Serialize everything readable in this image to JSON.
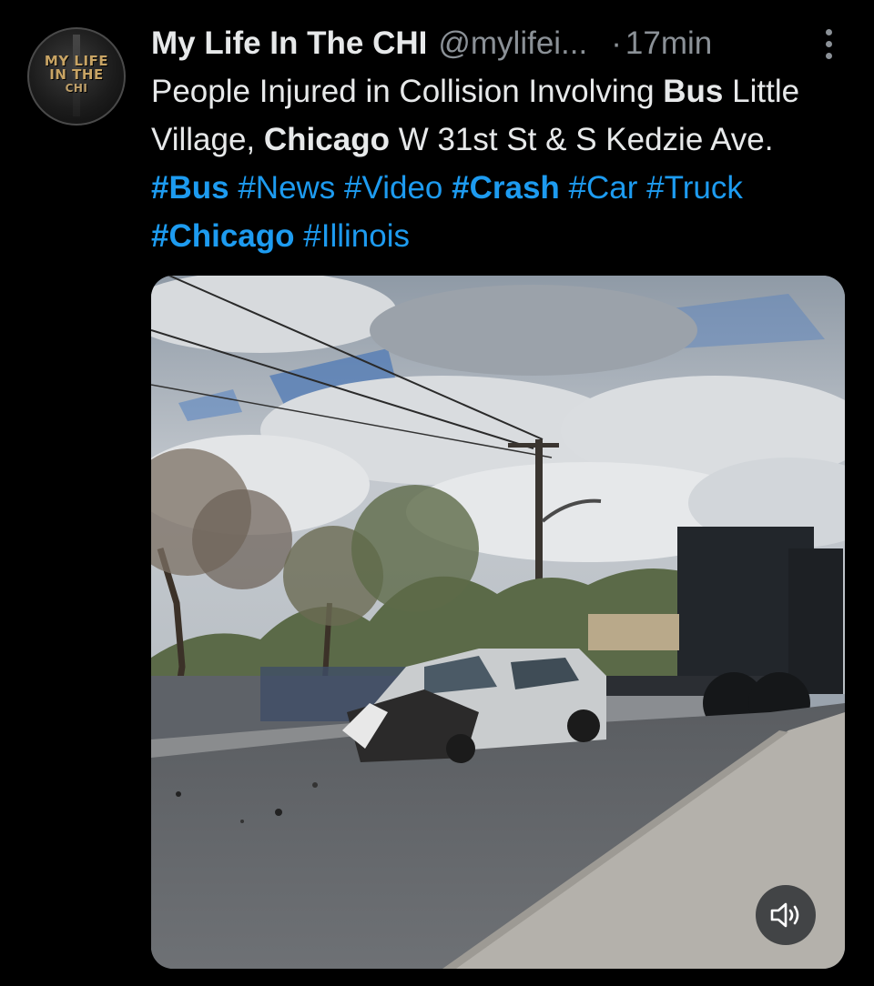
{
  "account": {
    "display_name": "My Life In The CHI",
    "handle": "@mylifei...",
    "separator": "·",
    "time": "17min",
    "avatar_logo_lines": [
      "MY LIFE",
      "IN THE",
      "CHI"
    ]
  },
  "tweet": {
    "text_1": "People Injured in Collision Involving ",
    "text_bus": "Bus",
    "text_2": " Little Village, ",
    "text_chicago": "Chicago",
    "text_3": " W 31st St & S Kedzie Ave. ",
    "hashtags": [
      {
        "label": "#",
        "word": "Bus",
        "bold": true
      },
      {
        "label": "#",
        "word": "News",
        "bold": false
      },
      {
        "label": "#",
        "word": "Video",
        "bold": false
      },
      {
        "label": "#",
        "word": "Crash",
        "bold": true
      },
      {
        "label": "#",
        "word": "Car",
        "bold": false
      },
      {
        "label": "#",
        "word": "Truck",
        "bold": false
      },
      {
        "label": "#",
        "word": "Chicago",
        "bold": true
      },
      {
        "label": "#",
        "word": "Illinois",
        "bold": false
      }
    ]
  },
  "media": {
    "type": "video",
    "description_icon": "speaker-muted-icon"
  },
  "colors": {
    "background": "#000000",
    "text": "#e7e9ea",
    "muted": "#8b9197",
    "link": "#1d9bf0"
  }
}
